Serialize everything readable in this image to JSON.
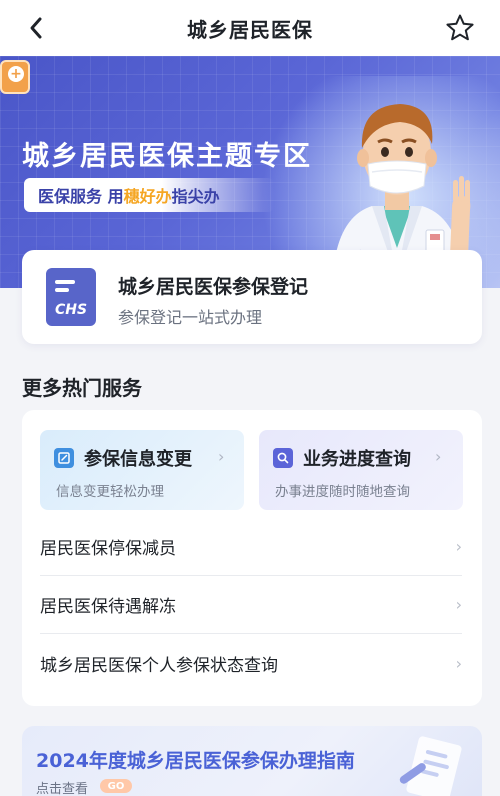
{
  "navbar": {
    "title": "城乡居民医保",
    "back_icon": "chevron-left-icon",
    "favorite_icon": "star-outline-icon"
  },
  "banner": {
    "title": "城乡居民医保主题专区",
    "slogan_part1": "医保服务 用",
    "slogan_accent": "穗好办",
    "slogan_part2": "指尖办",
    "accent_color": "#f5a623"
  },
  "register_card": {
    "icon_text": "CHS",
    "title": "城乡居民医保参保登记",
    "subtitle": "参保登记一站式办理"
  },
  "more_services": {
    "title": "更多热门服务",
    "tiles": [
      {
        "title": "参保信息变更",
        "subtitle": "信息变更轻松办理",
        "icon": "edit-icon"
      },
      {
        "title": "业务进度查询",
        "subtitle": "办事进度随时随地查询",
        "icon": "search-icon"
      }
    ],
    "list": [
      {
        "label": "居民医保停保减员"
      },
      {
        "label": "居民医保待遇解冻"
      },
      {
        "label": "城乡居民医保个人参保状态查询"
      }
    ]
  },
  "guide": {
    "title": "2024年度城乡居民医保参保办理指南",
    "link_text": "点击查看",
    "badge": "GO"
  },
  "colors": {
    "brand": "#5a66d6",
    "guide_title": "#4a62d6"
  }
}
